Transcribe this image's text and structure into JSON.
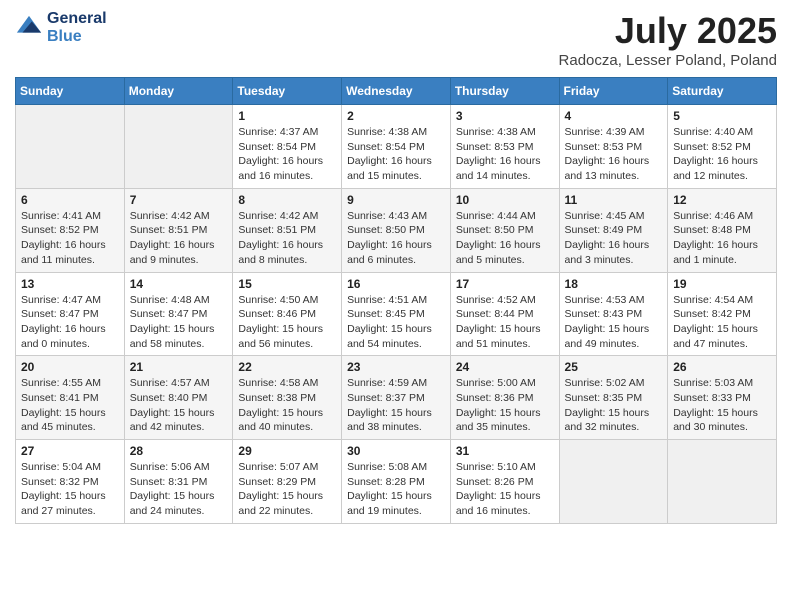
{
  "header": {
    "logo_line1": "General",
    "logo_line2": "Blue",
    "month_year": "July 2025",
    "location": "Radocza, Lesser Poland, Poland"
  },
  "days_of_week": [
    "Sunday",
    "Monday",
    "Tuesday",
    "Wednesday",
    "Thursday",
    "Friday",
    "Saturday"
  ],
  "weeks": [
    [
      {
        "num": "",
        "empty": true
      },
      {
        "num": "",
        "empty": true
      },
      {
        "num": "1",
        "info": "Sunrise: 4:37 AM\nSunset: 8:54 PM\nDaylight: 16 hours and 16 minutes."
      },
      {
        "num": "2",
        "info": "Sunrise: 4:38 AM\nSunset: 8:54 PM\nDaylight: 16 hours and 15 minutes."
      },
      {
        "num": "3",
        "info": "Sunrise: 4:38 AM\nSunset: 8:53 PM\nDaylight: 16 hours and 14 minutes."
      },
      {
        "num": "4",
        "info": "Sunrise: 4:39 AM\nSunset: 8:53 PM\nDaylight: 16 hours and 13 minutes."
      },
      {
        "num": "5",
        "info": "Sunrise: 4:40 AM\nSunset: 8:52 PM\nDaylight: 16 hours and 12 minutes."
      }
    ],
    [
      {
        "num": "6",
        "info": "Sunrise: 4:41 AM\nSunset: 8:52 PM\nDaylight: 16 hours and 11 minutes."
      },
      {
        "num": "7",
        "info": "Sunrise: 4:42 AM\nSunset: 8:51 PM\nDaylight: 16 hours and 9 minutes."
      },
      {
        "num": "8",
        "info": "Sunrise: 4:42 AM\nSunset: 8:51 PM\nDaylight: 16 hours and 8 minutes."
      },
      {
        "num": "9",
        "info": "Sunrise: 4:43 AM\nSunset: 8:50 PM\nDaylight: 16 hours and 6 minutes."
      },
      {
        "num": "10",
        "info": "Sunrise: 4:44 AM\nSunset: 8:50 PM\nDaylight: 16 hours and 5 minutes."
      },
      {
        "num": "11",
        "info": "Sunrise: 4:45 AM\nSunset: 8:49 PM\nDaylight: 16 hours and 3 minutes."
      },
      {
        "num": "12",
        "info": "Sunrise: 4:46 AM\nSunset: 8:48 PM\nDaylight: 16 hours and 1 minute."
      }
    ],
    [
      {
        "num": "13",
        "info": "Sunrise: 4:47 AM\nSunset: 8:47 PM\nDaylight: 16 hours and 0 minutes."
      },
      {
        "num": "14",
        "info": "Sunrise: 4:48 AM\nSunset: 8:47 PM\nDaylight: 15 hours and 58 minutes."
      },
      {
        "num": "15",
        "info": "Sunrise: 4:50 AM\nSunset: 8:46 PM\nDaylight: 15 hours and 56 minutes."
      },
      {
        "num": "16",
        "info": "Sunrise: 4:51 AM\nSunset: 8:45 PM\nDaylight: 15 hours and 54 minutes."
      },
      {
        "num": "17",
        "info": "Sunrise: 4:52 AM\nSunset: 8:44 PM\nDaylight: 15 hours and 51 minutes."
      },
      {
        "num": "18",
        "info": "Sunrise: 4:53 AM\nSunset: 8:43 PM\nDaylight: 15 hours and 49 minutes."
      },
      {
        "num": "19",
        "info": "Sunrise: 4:54 AM\nSunset: 8:42 PM\nDaylight: 15 hours and 47 minutes."
      }
    ],
    [
      {
        "num": "20",
        "info": "Sunrise: 4:55 AM\nSunset: 8:41 PM\nDaylight: 15 hours and 45 minutes."
      },
      {
        "num": "21",
        "info": "Sunrise: 4:57 AM\nSunset: 8:40 PM\nDaylight: 15 hours and 42 minutes."
      },
      {
        "num": "22",
        "info": "Sunrise: 4:58 AM\nSunset: 8:38 PM\nDaylight: 15 hours and 40 minutes."
      },
      {
        "num": "23",
        "info": "Sunrise: 4:59 AM\nSunset: 8:37 PM\nDaylight: 15 hours and 38 minutes."
      },
      {
        "num": "24",
        "info": "Sunrise: 5:00 AM\nSunset: 8:36 PM\nDaylight: 15 hours and 35 minutes."
      },
      {
        "num": "25",
        "info": "Sunrise: 5:02 AM\nSunset: 8:35 PM\nDaylight: 15 hours and 32 minutes."
      },
      {
        "num": "26",
        "info": "Sunrise: 5:03 AM\nSunset: 8:33 PM\nDaylight: 15 hours and 30 minutes."
      }
    ],
    [
      {
        "num": "27",
        "info": "Sunrise: 5:04 AM\nSunset: 8:32 PM\nDaylight: 15 hours and 27 minutes."
      },
      {
        "num": "28",
        "info": "Sunrise: 5:06 AM\nSunset: 8:31 PM\nDaylight: 15 hours and 24 minutes."
      },
      {
        "num": "29",
        "info": "Sunrise: 5:07 AM\nSunset: 8:29 PM\nDaylight: 15 hours and 22 minutes."
      },
      {
        "num": "30",
        "info": "Sunrise: 5:08 AM\nSunset: 8:28 PM\nDaylight: 15 hours and 19 minutes."
      },
      {
        "num": "31",
        "info": "Sunrise: 5:10 AM\nSunset: 8:26 PM\nDaylight: 15 hours and 16 minutes."
      },
      {
        "num": "",
        "empty": true
      },
      {
        "num": "",
        "empty": true
      }
    ]
  ]
}
